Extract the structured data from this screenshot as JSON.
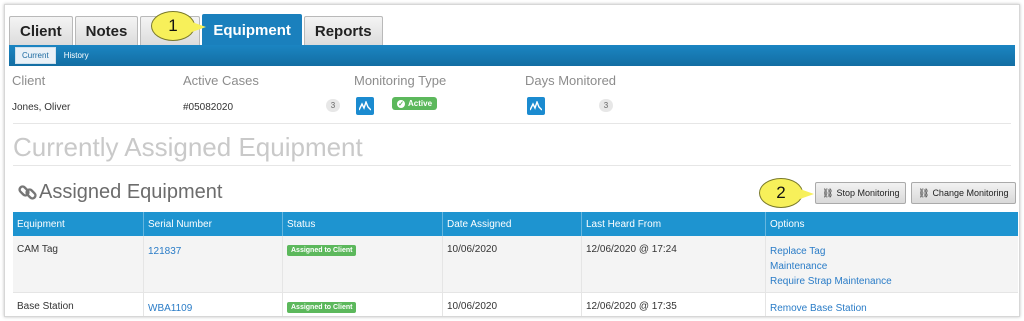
{
  "tabs": [
    {
      "label": "Client",
      "active": false
    },
    {
      "label": "Notes",
      "active": false
    },
    {
      "label": "",
      "active": false
    },
    {
      "label": "Equipment",
      "active": true
    },
    {
      "label": "Reports",
      "active": false
    }
  ],
  "callouts": {
    "one": "1",
    "two": "2"
  },
  "subtabs": {
    "current": "Current",
    "history": "History"
  },
  "info": {
    "client_label": "Client",
    "client_value": "Jones, Oliver",
    "cases_label": "Active Cases",
    "cases_value": "#05082020",
    "cases_count": "3",
    "monitoring_label": "Monitoring Type",
    "monitoring_status": "Active",
    "days_label": "Days Monitored",
    "days_count": "3"
  },
  "page_title": "Currently Assigned Equipment",
  "section_title": "Assigned Equipment",
  "buttons": {
    "stop": "Stop Monitoring",
    "change": "Change Monitoring"
  },
  "table": {
    "headers": [
      "Equipment",
      "Serial Number",
      "Status",
      "Date Assigned",
      "Last Heard From",
      "Options"
    ],
    "rows": [
      {
        "equipment": "CAM Tag",
        "serial": "121837",
        "status": "Assigned to Client",
        "date_assigned": "10/06/2020",
        "last_heard": "12/06/2020 @ 17:24",
        "options": [
          "Replace Tag",
          "Maintenance",
          "Require Strap Maintenance"
        ]
      },
      {
        "equipment": "Base Station",
        "serial": "WBA1109",
        "status": "Assigned to Client",
        "date_assigned": "10/06/2020",
        "last_heard": "12/06/2020 @ 17:35",
        "options": [
          "Remove Base Station"
        ]
      }
    ]
  },
  "colors": {
    "primary_blue": "#1a80bd",
    "table_header": "#1e94d0",
    "status_green": "#5cb85c",
    "link_blue": "#2a7cc7",
    "callout_yellow": "#f7f05a"
  }
}
